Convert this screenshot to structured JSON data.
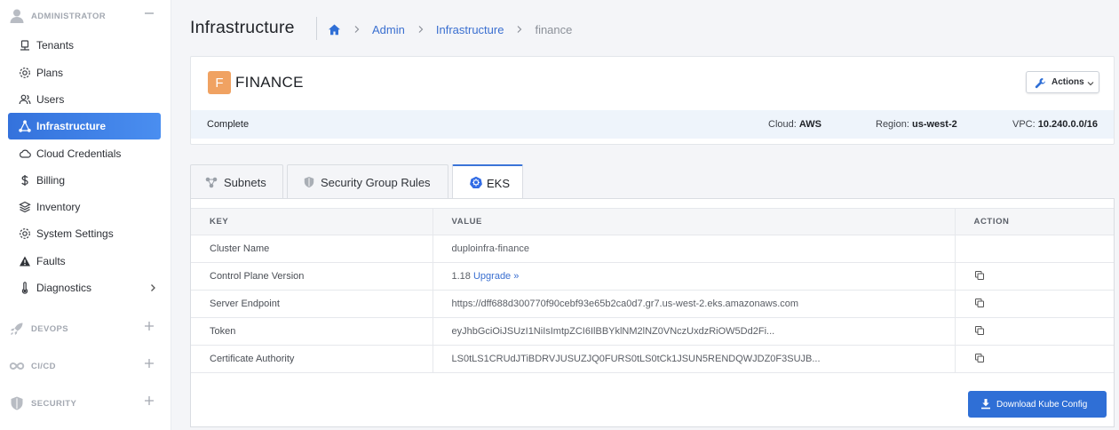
{
  "sidebar": {
    "sections": [
      {
        "label": "ADMINISTRATOR",
        "icon": "user-icon",
        "toggle": "minus-icon"
      },
      {
        "label": "DEVOPS",
        "icon": "rocket-icon",
        "toggle": "plus-icon"
      },
      {
        "label": "CI/CD",
        "icon": "infinity-icon",
        "toggle": "plus-icon"
      },
      {
        "label": "SECURITY",
        "icon": "shield-icon",
        "toggle": "plus-icon"
      }
    ],
    "items": [
      {
        "label": "Tenants",
        "icon": "tenant-icon"
      },
      {
        "label": "Plans",
        "icon": "gear-icon"
      },
      {
        "label": "Users",
        "icon": "users-icon"
      },
      {
        "label": "Infrastructure",
        "icon": "network-icon",
        "active": true
      },
      {
        "label": "Cloud Credentials",
        "icon": "cloud-icon"
      },
      {
        "label": "Billing",
        "icon": "dollar-icon"
      },
      {
        "label": "Inventory",
        "icon": "layers-icon"
      },
      {
        "label": "System Settings",
        "icon": "gear-icon"
      },
      {
        "label": "Faults",
        "icon": "warning-icon"
      },
      {
        "label": "Diagnostics",
        "icon": "thermometer-icon",
        "has_children": true
      }
    ]
  },
  "header": {
    "title": "Infrastructure",
    "breadcrumb": [
      "Admin",
      "Infrastructure",
      "finance"
    ]
  },
  "infra": {
    "badge": "F",
    "name": "FINANCE",
    "actions_label": "Actions",
    "status": "Complete",
    "cloud_label": "Cloud:",
    "cloud": "AWS",
    "region_label": "Region:",
    "region": "us-west-2",
    "vpc_label": "VPC:",
    "vpc": "10.240.0.0/16"
  },
  "tabs": [
    {
      "label": "Subnets",
      "icon": "subnet-icon"
    },
    {
      "label": "Security Group Rules",
      "icon": "shield-icon"
    },
    {
      "label": "EKS",
      "icon": "kubernetes-icon",
      "active": true
    }
  ],
  "table": {
    "columns": [
      "KEY",
      "VALUE",
      "ACTION"
    ],
    "rows": [
      {
        "key": "Cluster Name",
        "value": "duploinfra-finance",
        "copy": false
      },
      {
        "key": "Control Plane Version",
        "value": "1.18",
        "link": "Upgrade »",
        "copy": true
      },
      {
        "key": "Server Endpoint",
        "value": "https://dff688d300770f90cebf93e65b2ca0d7.gr7.us-west-2.eks.amazonaws.com",
        "copy": true
      },
      {
        "key": "Token",
        "value": "eyJhbGciOiJSUzI1NiIsImtpZCI6IlBBYklNM2lNZ0VNczUxdzRiOW5Dd2Fi...",
        "copy": true
      },
      {
        "key": "Certificate Authority",
        "value": "LS0tLS1CRUdJTiBDRVJUSUZJQ0FURS0tLS0tCk1JSUN5RENDQWJDZ0F3SUJB...",
        "copy": true
      }
    ]
  },
  "download_label": "Download Kube Config",
  "colors": {
    "accent": "#3472dc",
    "badge": "#f0a262",
    "link": "#3a6fd0"
  }
}
